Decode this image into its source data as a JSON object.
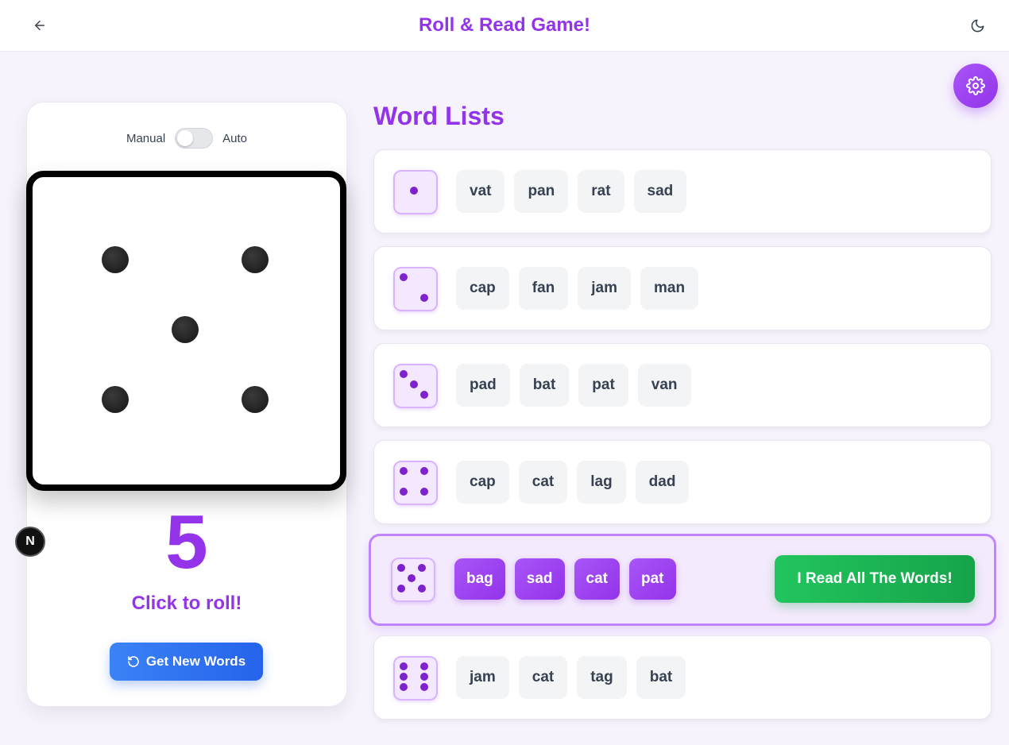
{
  "header": {
    "title": "Roll & Read Game!",
    "back_icon": "arrow-left-icon",
    "theme_icon": "moon-icon"
  },
  "settings": {
    "icon": "gear-icon"
  },
  "roller": {
    "mode_manual": "Manual",
    "mode_auto": "Auto",
    "auto_enabled": false,
    "die_value": 5,
    "result": "5",
    "hint": "Click to roll!",
    "new_words_label": "Get New Words",
    "new_words_icon": "refresh-icon"
  },
  "devtools": {
    "label": "N"
  },
  "word_lists": {
    "title": "Word Lists",
    "rows": [
      {
        "face": 1,
        "words": [
          "vat",
          "pan",
          "rat",
          "sad"
        ]
      },
      {
        "face": 2,
        "words": [
          "cap",
          "fan",
          "jam",
          "man"
        ]
      },
      {
        "face": 3,
        "words": [
          "pad",
          "bat",
          "pat",
          "van"
        ]
      },
      {
        "face": 4,
        "words": [
          "cap",
          "cat",
          "lag",
          "dad"
        ]
      },
      {
        "face": 5,
        "words": [
          "bag",
          "sad",
          "cat",
          "pat"
        ],
        "active": true,
        "action_label": "I Read All The Words!"
      },
      {
        "face": 6,
        "words": [
          "jam",
          "cat",
          "tag",
          "bat"
        ]
      }
    ]
  },
  "colors": {
    "accent": "#9333ea",
    "button_blue": "#2563eb",
    "button_green": "#16a34a"
  }
}
